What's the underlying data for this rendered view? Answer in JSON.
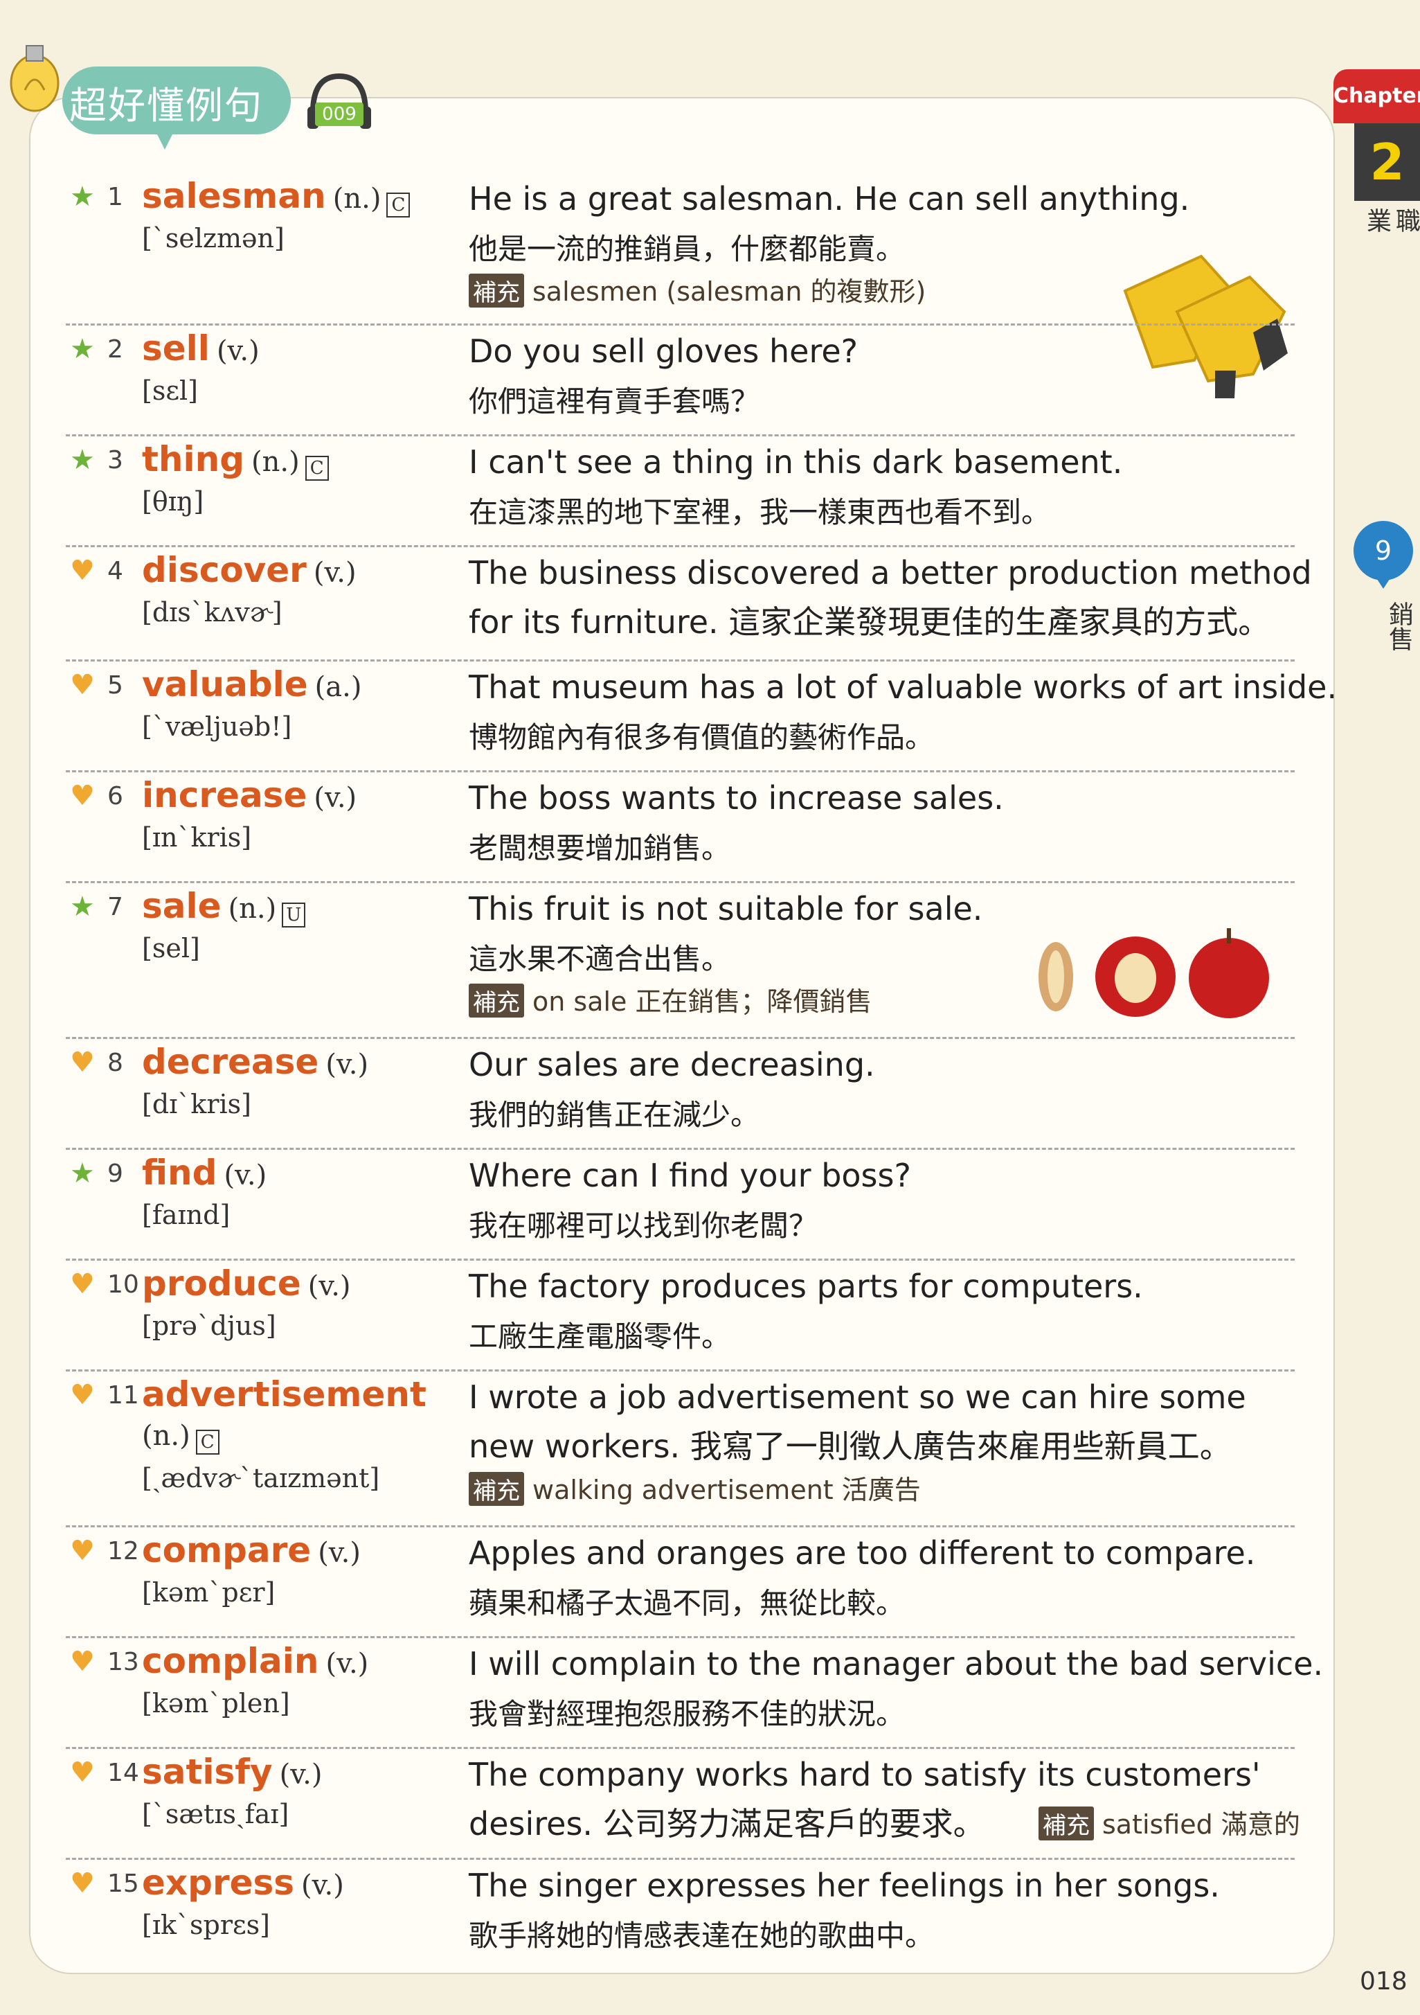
{
  "header": {
    "title": "超好懂例句",
    "track": "009"
  },
  "tab": {
    "chapter": "Chapter",
    "number": "2",
    "category": "職業"
  },
  "lesson": {
    "number": "9",
    "category": "銷售"
  },
  "page_number": "018",
  "entries": [
    {
      "num": "1",
      "mark": "star",
      "word": "salesman",
      "pos": "(n.)",
      "count": "C",
      "ipa": "[ˋselzmən]",
      "sentence": "He is a great salesman. He can sell anything.",
      "zh": "他是一流的推銷員，什麼都能賣。",
      "note_tag": "補充",
      "note": "salesmen (salesman 的複數形)"
    },
    {
      "num": "2",
      "mark": "star",
      "word": "sell",
      "pos": "(v.)",
      "ipa": "[sɛl]",
      "sentence": "Do you sell gloves here?",
      "zh": "你們這裡有賣手套嗎？"
    },
    {
      "num": "3",
      "mark": "star",
      "word": "thing",
      "pos": "(n.)",
      "count": "C",
      "ipa": "[θɪŋ]",
      "sentence": "I can't see a thing in this dark basement.",
      "zh": "在這漆黑的地下室裡，我一樣東西也看不到。"
    },
    {
      "num": "4",
      "mark": "heart",
      "word": "discover",
      "pos": "(v.)",
      "ipa": "[dɪsˋkʌvɚ]",
      "sentence": "The business discovered a better production method",
      "sentence2": "for its furniture. 這家企業發現更佳的生產家具的方式。"
    },
    {
      "num": "5",
      "mark": "heart",
      "word": "valuable",
      "pos": "(a.)",
      "ipa": "[ˋvæljuəb!]",
      "sentence": "That museum has a lot of valuable works of art inside.",
      "zh": "博物館內有很多有價值的藝術作品。"
    },
    {
      "num": "6",
      "mark": "heart",
      "word": "increase",
      "pos": "(v.)",
      "ipa": "[ɪnˋkris]",
      "sentence": "The boss wants to increase sales.",
      "zh": "老闆想要增加銷售。"
    },
    {
      "num": "7",
      "mark": "star",
      "word": "sale",
      "pos": "(n.)",
      "count": "U",
      "ipa": "[sel]",
      "sentence": "This fruit is not suitable for sale.",
      "zh": "這水果不適合出售。",
      "note_tag": "補充",
      "note": "on sale 正在銷售；降價銷售"
    },
    {
      "num": "8",
      "mark": "heart",
      "word": "decrease",
      "pos": "(v.)",
      "ipa": "[dɪˋkris]",
      "sentence": "Our sales are decreasing.",
      "zh": "我們的銷售正在減少。"
    },
    {
      "num": "9",
      "mark": "star",
      "word": "find",
      "pos": "(v.)",
      "ipa": "[faɪnd]",
      "sentence": "Where can I find your boss?",
      "zh": "我在哪裡可以找到你老闆？"
    },
    {
      "num": "10",
      "mark": "heart",
      "word": "produce",
      "pos": "(v.)",
      "ipa": "[prəˋdjus]",
      "sentence": "The factory produces parts for computers.",
      "zh": "工廠生產電腦零件。"
    },
    {
      "num": "11",
      "mark": "heart",
      "word": "advertisement",
      "pos": "(n.)",
      "count": "C",
      "ipa": "[ˏædvɚˋtaɪzmənt]",
      "sentence": "I wrote a job advertisement so we can hire some",
      "sentence2": "new workers. 我寫了一則徵人廣告來雇用些新員工。",
      "note_tag": "補充",
      "note": "walking advertisement 活廣告"
    },
    {
      "num": "12",
      "mark": "heart",
      "word": "compare",
      "pos": "(v.)",
      "ipa": "[kəmˋpɛr]",
      "sentence": "Apples and oranges are too different to compare.",
      "zh": "蘋果和橘子太過不同，無從比較。"
    },
    {
      "num": "13",
      "mark": "heart",
      "word": "complain",
      "pos": "(v.)",
      "ipa": "[kəmˋplen]",
      "sentence": "I will complain to the manager about the bad service.",
      "zh": "我會對經理抱怨服務不佳的狀況。"
    },
    {
      "num": "14",
      "mark": "heart",
      "word": "satisfy",
      "pos": "(v.)",
      "ipa": "[ˋsætɪsˏfaɪ]",
      "sentence": "The company works hard to satisfy its customers'",
      "sentence2": "desires. 公司努力滿足客戶的要求。",
      "note_tag": "補充",
      "note": "satisfied 滿意的"
    },
    {
      "num": "15",
      "mark": "heart",
      "word": "express",
      "pos": "(v.)",
      "ipa": "[ɪkˋsprɛs]",
      "sentence": "The singer expresses her feelings in her songs.",
      "zh": "歌手將她的情感表達在她的歌曲中。"
    }
  ]
}
